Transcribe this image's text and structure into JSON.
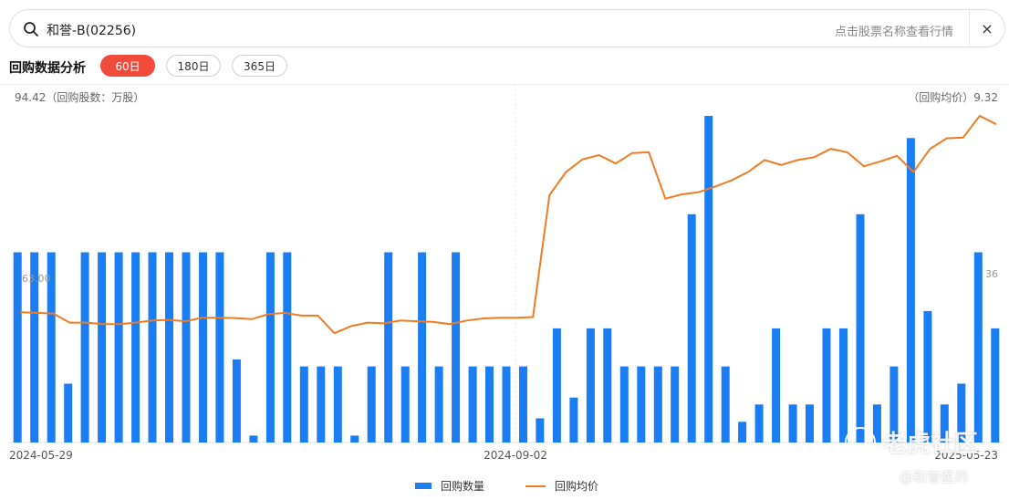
{
  "search": {
    "query": "和誉-B(02256)",
    "hint": "点击股票名称查看行情",
    "close_label": "×"
  },
  "header": {
    "title": "回购数据分析",
    "ranges": [
      {
        "label": "60日",
        "active": true
      },
      {
        "label": "180日",
        "active": false
      },
      {
        "label": "365日",
        "active": false
      }
    ]
  },
  "colors": {
    "bar": "#1a7df2",
    "line": "#f07b22",
    "active_tab": "#f24a3b"
  },
  "chart_data": {
    "type": "bar",
    "left_axis_label": "94.42（回购股数：万股）",
    "right_axis_label": "（回购均价）9.32",
    "left_mid_tick": "63.00",
    "right_mid_tick": "36",
    "x_tick_labels": [
      "2024-05-29",
      "2024-09-02",
      "2025-05-23"
    ],
    "ylim_left": [
      0,
      94.42
    ],
    "series": [
      {
        "name": "回购数量",
        "type": "bar",
        "values": [
          55,
          55,
          55,
          17,
          55,
          55,
          55,
          55,
          55,
          55,
          55,
          55,
          55,
          24,
          2,
          55,
          55,
          22,
          22,
          22,
          2,
          22,
          55,
          22,
          55,
          22,
          55,
          22,
          22,
          22,
          22,
          7,
          33,
          13,
          33,
          33,
          22,
          22,
          22,
          22,
          66,
          94.42,
          22,
          6,
          11,
          33,
          11,
          11,
          33,
          33,
          66,
          11,
          22,
          88,
          38,
          11,
          17,
          55,
          33
        ]
      },
      {
        "name": "回购均价",
        "type": "line",
        "values": [
          3.72,
          3.7,
          3.68,
          3.42,
          3.42,
          3.38,
          3.38,
          3.42,
          3.48,
          3.5,
          3.46,
          3.56,
          3.56,
          3.55,
          3.52,
          3.66,
          3.7,
          3.62,
          3.62,
          3.12,
          3.32,
          3.42,
          3.4,
          3.48,
          3.46,
          3.44,
          3.38,
          3.48,
          3.54,
          3.56,
          3.56,
          3.58,
          7.06,
          7.72,
          8.08,
          8.2,
          7.96,
          8.26,
          8.28,
          6.96,
          7.08,
          7.14,
          7.3,
          7.48,
          7.72,
          8.06,
          7.92,
          8.06,
          8.14,
          8.38,
          8.28,
          7.88,
          8.02,
          8.18,
          7.72,
          8.38,
          8.68,
          8.7,
          9.32,
          9.08
        ]
      }
    ]
  },
  "legend": {
    "bar_label": "回购数量",
    "line_label": "回购均价"
  },
  "watermark": {
    "brand": "老虎社区",
    "handle": "@和誉医药"
  }
}
